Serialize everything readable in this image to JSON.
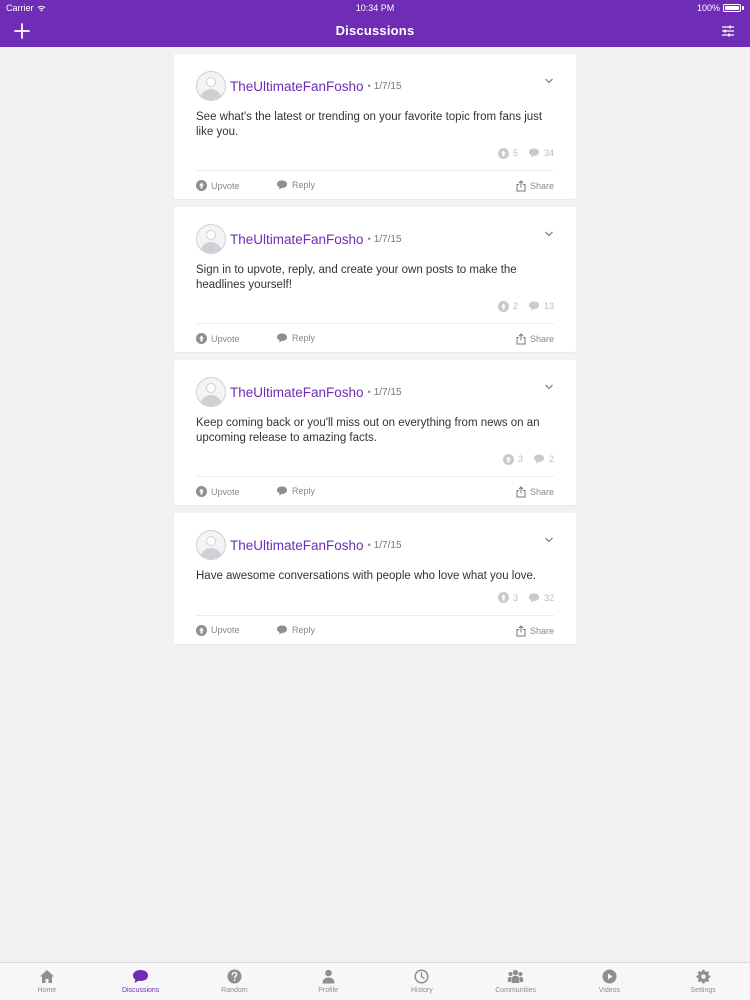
{
  "status_bar": {
    "carrier": "Carrier",
    "time": "10:34 PM",
    "battery": "100%"
  },
  "nav": {
    "title": "Discussions",
    "add_icon": "plus-icon",
    "filter_icon": "sliders-icon"
  },
  "colors": {
    "brand": "#6f2db5",
    "background": "#f2f2f4",
    "muted": "#8e8e93"
  },
  "posts": [
    {
      "author": "TheUltimateFanFosho",
      "separator": "•",
      "date": "1/7/15",
      "text": "See what's the latest or trending on your favorite topic from fans just like you.",
      "upvotes": "5",
      "comments": "34"
    },
    {
      "author": "TheUltimateFanFosho",
      "separator": "•",
      "date": "1/7/15",
      "text": "Sign in to upvote, reply, and create your own posts to make the headlines yourself!",
      "upvotes": "2",
      "comments": "13"
    },
    {
      "author": "TheUltimateFanFosho",
      "separator": "•",
      "date": "1/7/15",
      "text": "Keep coming back or you'll miss out on everything from news on an upcoming release to amazing facts.",
      "upvotes": "3",
      "comments": "2"
    },
    {
      "author": "TheUltimateFanFosho",
      "separator": "•",
      "date": "1/7/15",
      "text": "Have awesome conversations with people who love what you love.",
      "upvotes": "3",
      "comments": "32"
    }
  ],
  "actions": {
    "upvote": "Upvote",
    "reply": "Reply",
    "share": "Share"
  },
  "tabs": [
    {
      "label": "Home",
      "icon": "home-icon",
      "active": false
    },
    {
      "label": "Discussions",
      "icon": "chat-bubble-icon",
      "active": true
    },
    {
      "label": "Random",
      "icon": "question-icon",
      "active": false
    },
    {
      "label": "Profile",
      "icon": "person-icon",
      "active": false
    },
    {
      "label": "History",
      "icon": "clock-icon",
      "active": false
    },
    {
      "label": "Communities",
      "icon": "group-icon",
      "active": false
    },
    {
      "label": "Videos",
      "icon": "play-icon",
      "active": false
    },
    {
      "label": "Settings",
      "icon": "gear-icon",
      "active": false
    }
  ]
}
